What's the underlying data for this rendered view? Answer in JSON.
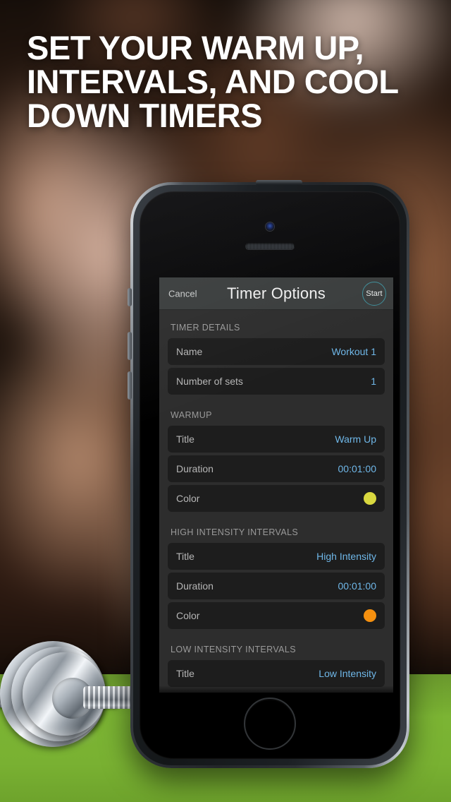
{
  "headline": {
    "line1": "SET YOUR WARM UP,",
    "line2": "INTERVALS, AND COOL",
    "line3": "DOWN TIMERS"
  },
  "app": {
    "navbar": {
      "cancel_label": "Cancel",
      "title": "Timer Options",
      "start_label": "Start",
      "start_color": "#3f8f9b"
    },
    "sections": [
      {
        "header": "TIMER DETAILS",
        "rows": [
          {
            "label": "Name",
            "value": "Workout 1",
            "type": "text"
          },
          {
            "label": "Number of sets",
            "value": "1",
            "type": "text"
          }
        ]
      },
      {
        "header": "WARMUP",
        "rows": [
          {
            "label": "Title",
            "value": "Warm Up",
            "type": "text"
          },
          {
            "label": "Duration",
            "value": "00:01:00",
            "type": "text"
          },
          {
            "label": "Color",
            "value": "",
            "type": "color",
            "color": "#d9d83f"
          }
        ]
      },
      {
        "header": "HIGH INTENSITY INTERVALS",
        "rows": [
          {
            "label": "Title",
            "value": "High Intensity",
            "type": "text"
          },
          {
            "label": "Duration",
            "value": "00:01:00",
            "type": "text"
          },
          {
            "label": "Color",
            "value": "",
            "type": "color",
            "color": "#f5900f"
          }
        ]
      },
      {
        "header": "LOW INTENSITY INTERVALS",
        "rows": [
          {
            "label": "Title",
            "value": "Low Intensity",
            "type": "text"
          }
        ]
      }
    ],
    "value_color": "#6fb7e8",
    "label_color": "#b6b6b6",
    "row_bg": "#1d1d1d",
    "screen_bg": "#2d2d2d",
    "navbar_bg": "#3a3d3d"
  },
  "background": {
    "floor_color": "#7cb534",
    "headline_color": "#ffffff"
  }
}
